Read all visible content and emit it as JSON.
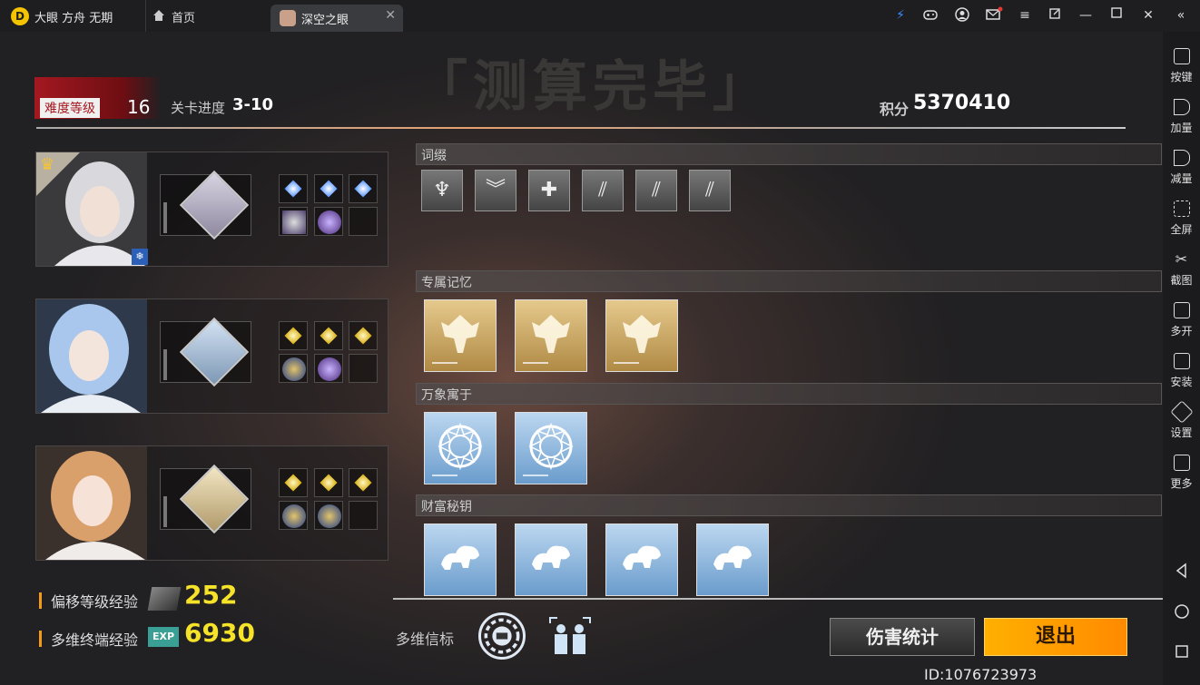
{
  "window": {
    "app_name": "大眼 方舟 无期",
    "tabs": [
      {
        "label": "首页"
      },
      {
        "label": "深空之眼"
      }
    ]
  },
  "sidebar": {
    "items": [
      {
        "label": "按键",
        "icon": "keyboard-icon"
      },
      {
        "label": "加量",
        "icon": "volume-up-icon"
      },
      {
        "label": "减量",
        "icon": "volume-down-icon"
      },
      {
        "label": "全屏",
        "icon": "fullscreen-icon"
      },
      {
        "label": "截图",
        "icon": "scissors-icon"
      },
      {
        "label": "多开",
        "icon": "multi-instance-icon"
      },
      {
        "label": "安装",
        "icon": "apk-install-icon"
      },
      {
        "label": "设置",
        "icon": "settings-icon"
      },
      {
        "label": "更多",
        "icon": "more-icon"
      }
    ]
  },
  "game": {
    "title": "「测算完毕」",
    "difficulty_label": "难度等级",
    "difficulty_value": "16",
    "progress_label": "关卡进度",
    "progress_value": "3-10",
    "score_label": "积分",
    "score_value": "5370410",
    "sections": {
      "affix": "词缀",
      "exclusive_memory": "专属记忆",
      "wanxiang": "万象寓于",
      "wealth_key": "财富秘钥"
    },
    "beacon_label": "多维信标",
    "offset_exp_label": "偏移等级经验",
    "offset_exp_value": "252",
    "terminal_exp_label": "多维终端经验",
    "terminal_exp_value": "6930",
    "exp_badge": "EXP",
    "buttons": {
      "stats": "伤害统计",
      "exit": "退出"
    },
    "id_text": "ID:1076723973",
    "colors": {
      "accent_red": "#a41820",
      "accent_orange": "#ff9a00",
      "exp_yellow": "#f7e22a",
      "gold_card": "#e5c98c",
      "blue_card": "#9ec2e6"
    }
  }
}
